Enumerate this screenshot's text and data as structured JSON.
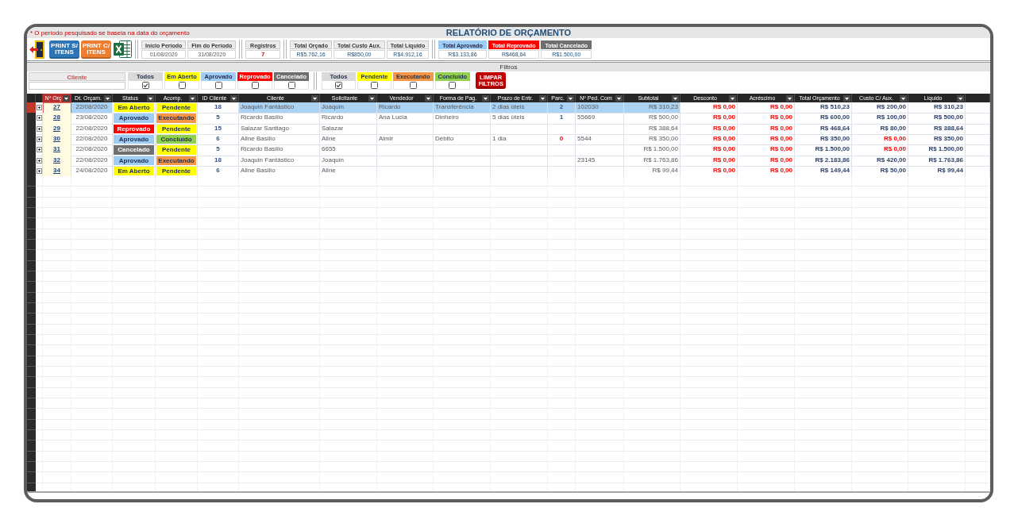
{
  "title_bar": {
    "note": "* O período pesquisado se baseia na data do orçamento",
    "title": "RELATÓRIO DE ORÇAMENTO"
  },
  "toolbar": {
    "buttons": [
      {
        "kind": "exit"
      },
      {
        "kind": "print",
        "label": "PRINT S/ ITENS",
        "color": "#2e75b6"
      },
      {
        "kind": "print",
        "label": "PRINT C/ ITENS",
        "color": "#ed7d31"
      },
      {
        "kind": "excel"
      }
    ],
    "summary_groups": [
      {
        "items": [
          {
            "label": "Início Período",
            "value": "01/08/2020",
            "kind": "date"
          },
          {
            "label": "Fim do Período",
            "value": "31/08/2020",
            "kind": "date"
          }
        ]
      },
      {
        "items": [
          {
            "label": "Registros",
            "value": "7",
            "kind": "count"
          }
        ]
      },
      {
        "items": [
          {
            "label": "Total Orçado",
            "value": "R$5.762,16",
            "kind": "money"
          },
          {
            "label": "Total Custo Aux.",
            "value": "R$850,00",
            "kind": "money"
          },
          {
            "label": "Total Líquido",
            "value": "R$4.912,16",
            "kind": "money"
          }
        ]
      },
      {
        "items": [
          {
            "label": "Total Aprovado",
            "value": "R$3.133,86",
            "kind": "money",
            "color": "#9fccf4"
          },
          {
            "label": "Total Reprovado",
            "value": "R$468,64",
            "kind": "money",
            "color": "#ff0000"
          },
          {
            "label": "Total Cancelado",
            "value": "R$1.500,00",
            "kind": "money",
            "color": "#6f6f6f"
          }
        ]
      }
    ]
  },
  "filters": {
    "title": "Filtros",
    "client": {
      "label": "Cliente"
    },
    "status": [
      {
        "label": "Todos",
        "color": "#d9d9d9",
        "checked": true
      },
      {
        "label": "Em Aberto",
        "color": "#ffff00",
        "checked": false
      },
      {
        "label": "Aprovado",
        "color": "#9fccf4",
        "checked": false
      },
      {
        "label": "Reprovado",
        "color": "#ff0000",
        "checked": false
      },
      {
        "label": "Cancelado",
        "color": "#6f6f6f",
        "checked": false
      }
    ],
    "progress": [
      {
        "label": "Todos",
        "color": "#d9d9d9",
        "checked": true
      },
      {
        "label": "Pendente",
        "color": "#ffff00",
        "checked": false
      },
      {
        "label": "Executando",
        "color": "#f79646",
        "checked": false
      },
      {
        "label": "Concluído",
        "color": "#92d050",
        "checked": false
      }
    ],
    "clear_button": "LIMPAR FILTROS"
  },
  "table": {
    "columns": [
      {
        "label": "Nº Orç",
        "kind": "link",
        "selected": true
      },
      {
        "label": "Dt. Orçam.",
        "kind": "date",
        "selected": false
      },
      {
        "label": "Status",
        "kind": "pill",
        "selected": false
      },
      {
        "label": "Acomp.",
        "kind": "pill",
        "selected": false
      },
      {
        "label": "ID Cliente",
        "kind": "id",
        "selected": false
      },
      {
        "label": "Cliente",
        "kind": "text",
        "selected": false
      },
      {
        "label": "Solicitante",
        "kind": "text",
        "selected": false
      },
      {
        "label": "Vendedor",
        "kind": "text",
        "selected": false
      },
      {
        "label": "Forma de Pag.",
        "kind": "text",
        "selected": false
      },
      {
        "label": "Prazo de Entr.",
        "kind": "text",
        "selected": false
      },
      {
        "label": "Parc.",
        "kind": "count",
        "selected": false
      },
      {
        "label": "Nº Ped. Com",
        "kind": "code",
        "selected": false
      },
      {
        "label": "Subtotal",
        "kind": "money",
        "selected": false
      },
      {
        "label": "Desconto",
        "kind": "flagged",
        "selected": false
      },
      {
        "label": "Acréscimo",
        "kind": "flagged",
        "selected": false
      },
      {
        "label": "Total Orçamento",
        "kind": "total",
        "selected": false
      },
      {
        "label": "Custo C/ Aux.",
        "kind": "flagged",
        "selected": false
      },
      {
        "label": "Líquido",
        "kind": "total",
        "selected": false
      }
    ],
    "rows": [
      {
        "selected": true,
        "cells": [
          "27",
          "22/08/2020",
          {
            "text": "Em Aberto",
            "color": "#ffff00"
          },
          {
            "text": "Pendente",
            "color": "#ffff00"
          },
          "18",
          "Joaquin Fantástico",
          "Joaquin",
          "Ricardo",
          "Transferência",
          "2 dias úteis",
          {
            "text": "2",
            "alert": false
          },
          "102030",
          "R$ 310,23",
          {
            "text": "R$ 0,00",
            "alert": true
          },
          {
            "text": "R$ 0,00",
            "alert": true
          },
          "R$ 510,23",
          {
            "text": "R$ 200,00",
            "alert": false
          },
          "R$ 310,23"
        ]
      },
      {
        "selected": false,
        "cells": [
          "28",
          "23/08/2020",
          {
            "text": "Aprovado",
            "color": "#9fccf4"
          },
          {
            "text": "Executando",
            "color": "#f79646"
          },
          "5",
          "Ricardo Basilio",
          "Ricardo",
          "Ana Lucia",
          "Dinheiro",
          "5 dias úteis",
          {
            "text": "1",
            "alert": false
          },
          "55669",
          "R$ 500,00",
          {
            "text": "R$ 0,00",
            "alert": true
          },
          {
            "text": "R$ 0,00",
            "alert": true
          },
          "R$ 600,00",
          {
            "text": "R$ 100,00",
            "alert": false
          },
          "R$ 500,00"
        ]
      },
      {
        "selected": false,
        "cells": [
          "29",
          "22/08/2020",
          {
            "text": "Reprovado",
            "color": "#ff0000"
          },
          {
            "text": "Pendente",
            "color": "#ffff00"
          },
          "15",
          "Salazar Santiago",
          "Salazar",
          null,
          null,
          null,
          null,
          null,
          "R$ 388,64",
          {
            "text": "R$ 0,00",
            "alert": true
          },
          {
            "text": "R$ 0,00",
            "alert": true
          },
          "R$ 468,64",
          {
            "text": "R$ 80,00",
            "alert": false
          },
          "R$ 388,64"
        ]
      },
      {
        "selected": false,
        "cells": [
          "30",
          "22/08/2020",
          {
            "text": "Aprovado",
            "color": "#9fccf4"
          },
          {
            "text": "Concluído",
            "color": "#92d050"
          },
          "6",
          "Aline Basilio",
          "Aline",
          "Almir",
          "Débito",
          "1 dia",
          {
            "text": "0",
            "alert": true
          },
          "5544",
          "R$ 350,00",
          {
            "text": "R$ 0,00",
            "alert": true
          },
          {
            "text": "R$ 0,00",
            "alert": true
          },
          "R$ 350,00",
          {
            "text": "R$ 0,00",
            "alert": true
          },
          "R$ 350,00"
        ]
      },
      {
        "selected": false,
        "cells": [
          "31",
          "22/08/2020",
          {
            "text": "Cancelado",
            "color": "#6f6f6f"
          },
          {
            "text": "Pendente",
            "color": "#ffff00"
          },
          "5",
          "Ricardo Basilio",
          "6655",
          null,
          null,
          null,
          null,
          null,
          "R$ 1.500,00",
          {
            "text": "R$ 0,00",
            "alert": true
          },
          {
            "text": "R$ 0,00",
            "alert": true
          },
          "R$ 1.500,00",
          {
            "text": "R$ 0,00",
            "alert": true
          },
          "R$ 1.500,00"
        ]
      },
      {
        "selected": false,
        "cells": [
          "32",
          "22/08/2020",
          {
            "text": "Aprovado",
            "color": "#9fccf4"
          },
          {
            "text": "Executando",
            "color": "#f79646"
          },
          "18",
          "Joaquin Fantástico",
          "Joaquin",
          null,
          null,
          null,
          null,
          "23145",
          "R$ 1.763,86",
          {
            "text": "R$ 0,00",
            "alert": true
          },
          {
            "text": "R$ 0,00",
            "alert": true
          },
          "R$ 2.183,86",
          {
            "text": "R$ 420,00",
            "alert": false
          },
          "R$ 1.763,86"
        ]
      },
      {
        "selected": false,
        "cells": [
          "34",
          "24/08/2020",
          {
            "text": "Em Aberto",
            "color": "#ffff00"
          },
          {
            "text": "Pendente",
            "color": "#ffff00"
          },
          "6",
          "Aline Basilio",
          "Aline",
          null,
          null,
          null,
          null,
          null,
          "R$ 99,44",
          {
            "text": "R$ 0,00",
            "alert": true
          },
          {
            "text": "R$ 0,00",
            "alert": true
          },
          "R$ 149,44",
          {
            "text": "R$ 50,00",
            "alert": false
          },
          "R$ 99,44"
        ]
      }
    ]
  }
}
